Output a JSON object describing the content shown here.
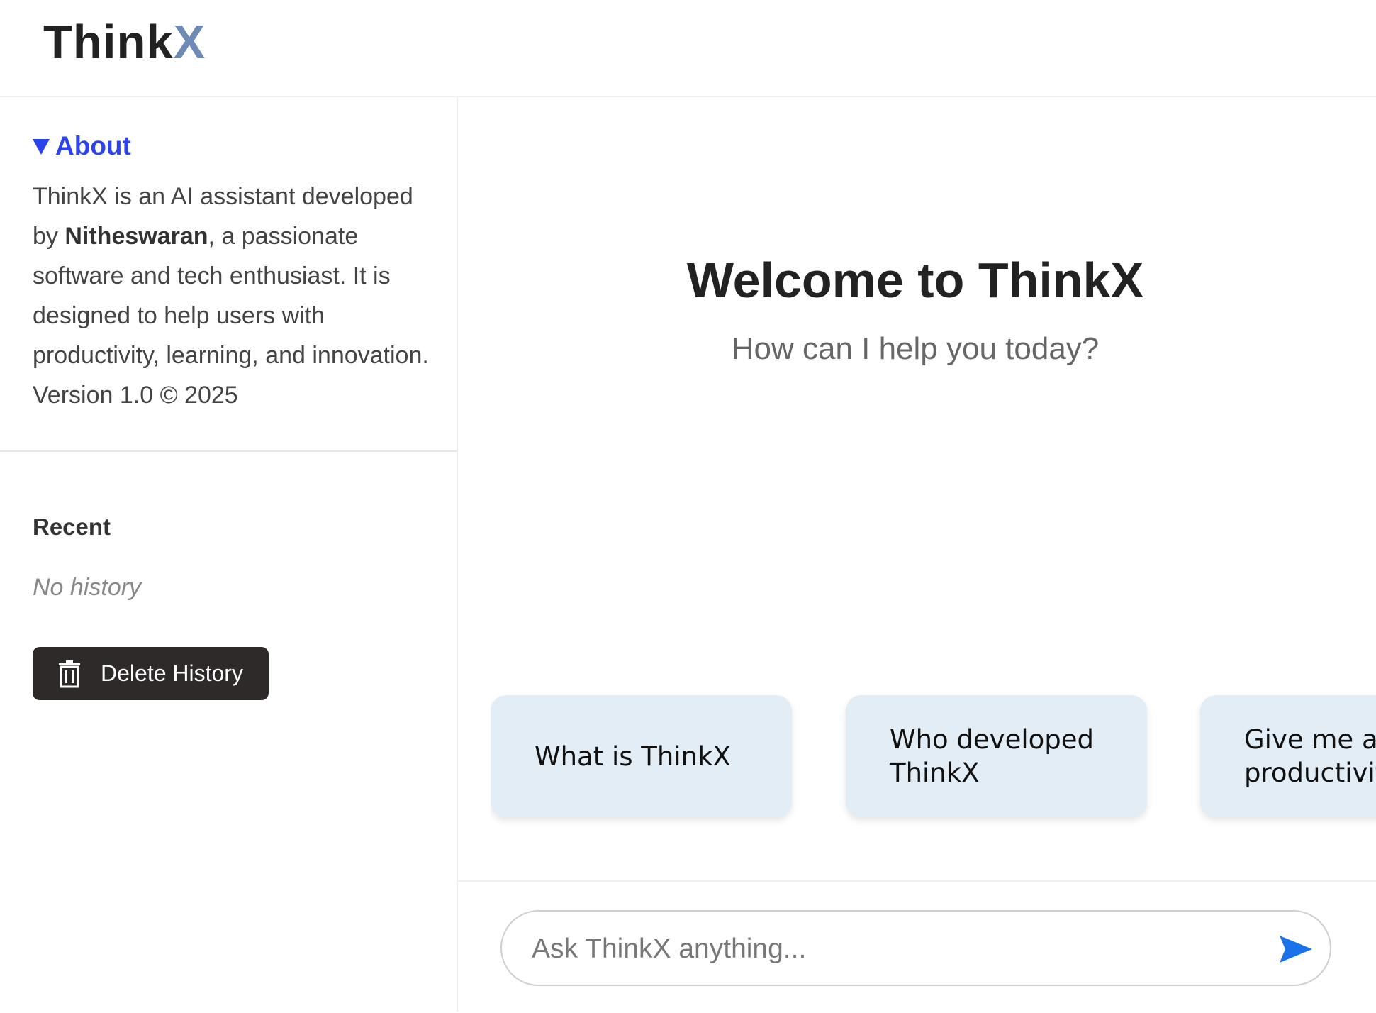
{
  "header": {
    "logo_main": "Think",
    "logo_accent": "X"
  },
  "sidebar": {
    "about": {
      "title": "About",
      "text_1": "ThinkX is an AI assistant developed by ",
      "developer": "Nitheswaran",
      "text_2": ", a passionate software and tech enthusiast. It is designed to help users with productivity, learning, and innovation. Version 1.0 © 2025"
    },
    "recent": {
      "title": "Recent",
      "empty_text": "No history"
    },
    "delete_button": {
      "label": "Delete History",
      "icon": "trash-icon"
    }
  },
  "main": {
    "welcome_title": "Welcome to ThinkX",
    "welcome_subtitle": "How can I help you today?",
    "suggestions": [
      {
        "label": "What is ThinkX"
      },
      {
        "label": "Who developed ThinkX"
      },
      {
        "label": "Give me a productivit"
      }
    ],
    "input": {
      "placeholder": "Ask ThinkX anything...",
      "value": ""
    },
    "send_icon": "send-icon"
  },
  "colors": {
    "accent_blue": "#2b44ee",
    "logo_accent": "#6d8bb4",
    "card_bg": "#e3edf6",
    "send_blue": "#1a73e8",
    "button_dark": "#2d2a29"
  }
}
